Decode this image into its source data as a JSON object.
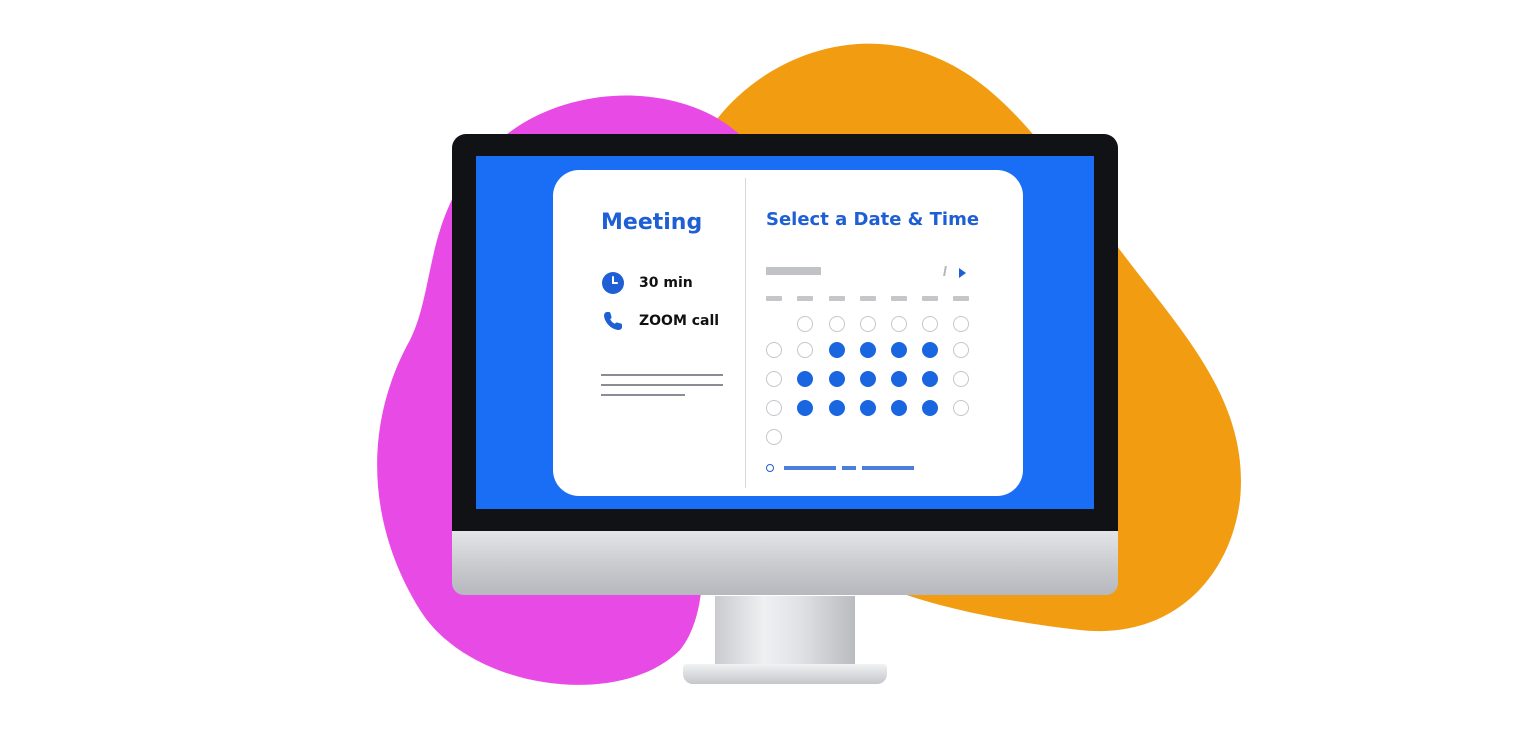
{
  "colors": {
    "pink_blob": "#e84ae6",
    "orange_blob": "#f29c12",
    "screen_blue": "#1a6ef5",
    "accent_blue": "#1e5fd6"
  },
  "booking": {
    "event_title": "Meeting",
    "duration": {
      "icon": "clock-icon",
      "label": "30 min"
    },
    "location": {
      "icon": "phone-icon",
      "label": "ZOOM call"
    },
    "calendar_title": "Select a Date & Time",
    "timezone_label": "",
    "available_day_count": 14
  }
}
